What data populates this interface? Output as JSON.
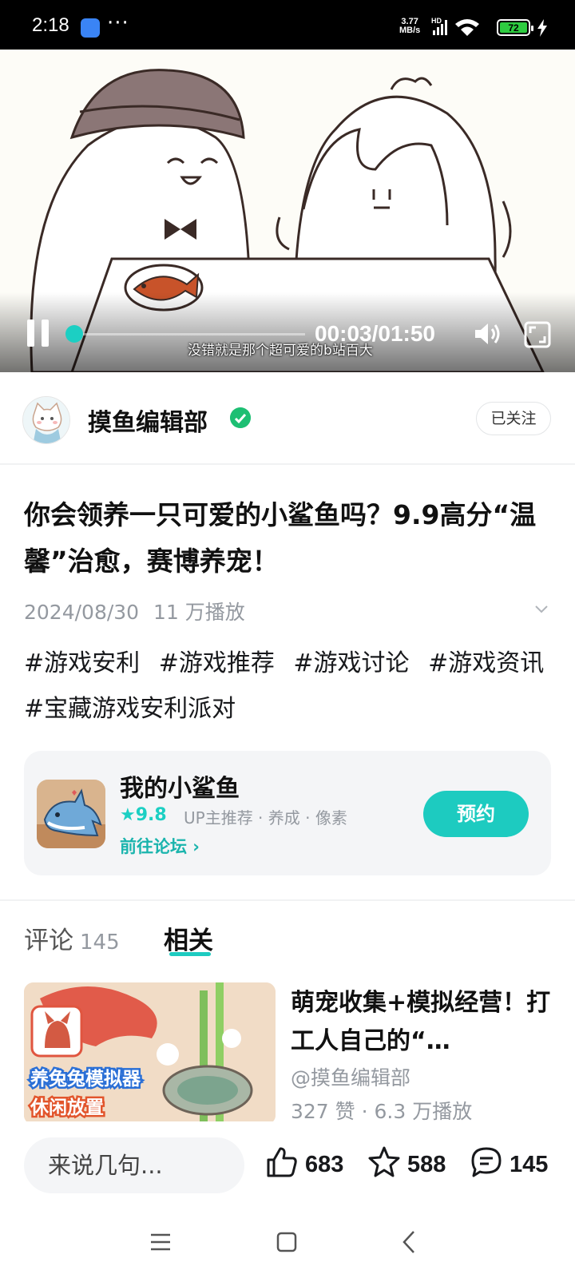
{
  "status_bar": {
    "time": "2:18",
    "dots": "···",
    "net_speed_value": "3.77",
    "net_speed_unit": "MB/s",
    "hd": "HD",
    "battery": "72"
  },
  "player": {
    "current_time": "00:03",
    "total_time": "01:50",
    "time_display": "00:03/01:50",
    "subtitle": "没错就是那个超可爱的b站百大",
    "progress": 0.03
  },
  "author": {
    "name": "摸鱼编辑部",
    "follow_label": "已关注"
  },
  "video": {
    "title": "你会领养一只可爱的小鲨鱼吗？9.9高分“温馨”治愈，赛博养宠！",
    "date": "2024/08/30",
    "plays": "11 万播放",
    "tags": [
      "#游戏安利",
      "#游戏推荐",
      "#游戏讨论",
      "#游戏资讯",
      "#宝藏游戏安利派对"
    ]
  },
  "game_card": {
    "name": "我的小鲨鱼",
    "rating": "9.8",
    "tags": "UP主推荐 · 养成 · 像素",
    "forum_link": "前往论坛",
    "reserve_label": "预约"
  },
  "tabs": {
    "comments_label": "评论",
    "comments_count": "145",
    "related_label": "相关"
  },
  "related": [
    {
      "title": "萌宠收集+模拟经营！打工人自己的“…",
      "author": "@摸鱼编辑部",
      "stats": "327 赞 · 6.3 万播放",
      "thumb_text_1": "养兔兔模拟器",
      "thumb_text_2": "休闲放置"
    }
  ],
  "bottom_bar": {
    "comment_placeholder": "来说几句...",
    "likes": "683",
    "favorites": "588",
    "comments": "145"
  },
  "colors": {
    "accent": "#1dcbc0",
    "verified": "#1dbf73",
    "muted": "#9499a0"
  }
}
